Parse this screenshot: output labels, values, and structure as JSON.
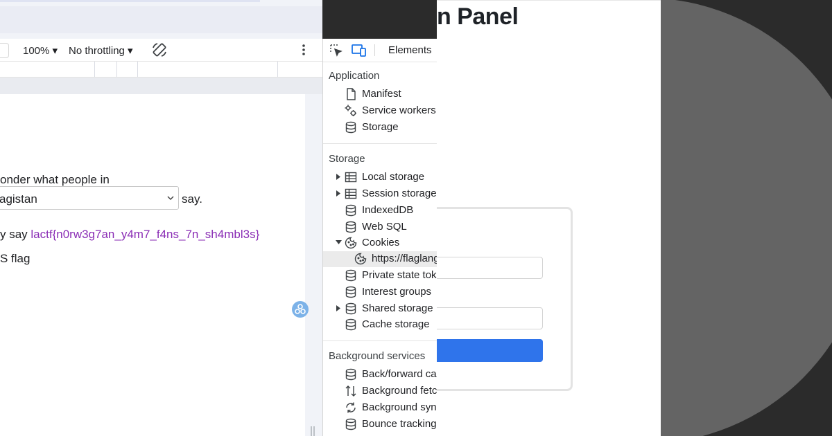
{
  "admin": {
    "title": "n Panel"
  },
  "device_toolbar": {
    "zoom": "100%",
    "throttle": "No throttling"
  },
  "webpage": {
    "line1": "onder what people in",
    "select_value": "agistan",
    "say_text": "say.",
    "flag_prefix": "y say ",
    "flag_value": "lactf{n0rw3g7an_y4m7_f4ns_7n_sh4mbl3s}",
    "line4": "S flag"
  },
  "devtools": {
    "tab_elements": "Elements",
    "sections": {
      "application": {
        "heading": "Application",
        "items": [
          {
            "label": "Manifest",
            "icon": "file-icon"
          },
          {
            "label": "Service workers",
            "icon": "gears-icon"
          },
          {
            "label": "Storage",
            "icon": "database-icon"
          }
        ]
      },
      "storage": {
        "heading": "Storage",
        "items": [
          {
            "label": "Local storage",
            "icon": "table-icon"
          },
          {
            "label": "Session storage",
            "icon": "table-icon"
          },
          {
            "label": "IndexedDB",
            "icon": "database-icon"
          },
          {
            "label": "Web SQL",
            "icon": "database-icon"
          },
          {
            "label": "Cookies",
            "icon": "cookie-icon"
          },
          {
            "label": "https://flaglang",
            "icon": "cookie-icon"
          },
          {
            "label": "Private state toke",
            "icon": "database-icon"
          },
          {
            "label": "Interest groups",
            "icon": "database-icon"
          },
          {
            "label": "Shared storage",
            "icon": "database-icon"
          },
          {
            "label": "Cache storage",
            "icon": "database-icon"
          }
        ]
      },
      "background": {
        "heading": "Background services",
        "items": [
          {
            "label": "Back/forward cac",
            "icon": "database-icon"
          },
          {
            "label": "Background fetch",
            "icon": "up-down-arrows-icon"
          },
          {
            "label": "Background sync",
            "icon": "sync-icon"
          },
          {
            "label": "Bounce tracking ",
            "icon": "database-icon"
          }
        ]
      }
    }
  }
}
